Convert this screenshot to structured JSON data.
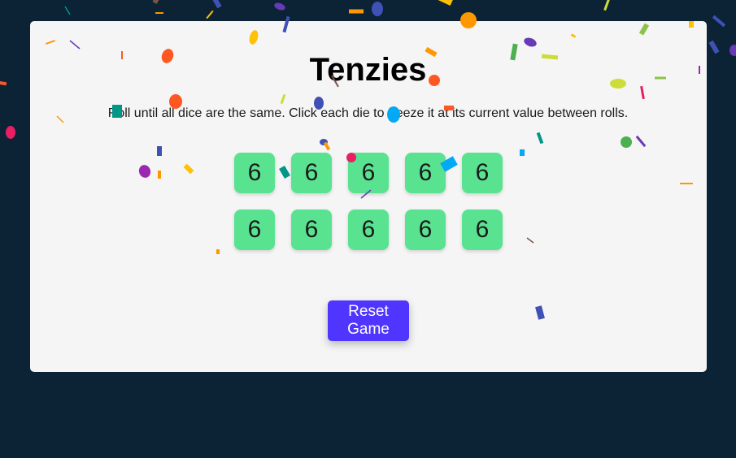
{
  "app": {
    "title": "Tenzies",
    "instructions": "Roll until all dice are the same. Click each die to freeze it at its current value between rolls."
  },
  "dice": [
    {
      "value": "6"
    },
    {
      "value": "6"
    },
    {
      "value": "6"
    },
    {
      "value": "6"
    },
    {
      "value": "6"
    },
    {
      "value": "6"
    },
    {
      "value": "6"
    },
    {
      "value": "6"
    },
    {
      "value": "6"
    },
    {
      "value": "6"
    }
  ],
  "controls": {
    "reset_label": "Reset Game"
  },
  "colors": {
    "background": "#0b2334",
    "card": "#f5f5f5",
    "die": "#59e391",
    "button": "#5035ff"
  },
  "confetti_colors": [
    "#ff5722",
    "#673ab7",
    "#3f51b5",
    "#ffc107",
    "#8bc34a",
    "#e91e63",
    "#03a9f4",
    "#009688",
    "#ff9800",
    "#cddc39",
    "#4caf50",
    "#9c27b0",
    "#795548"
  ]
}
